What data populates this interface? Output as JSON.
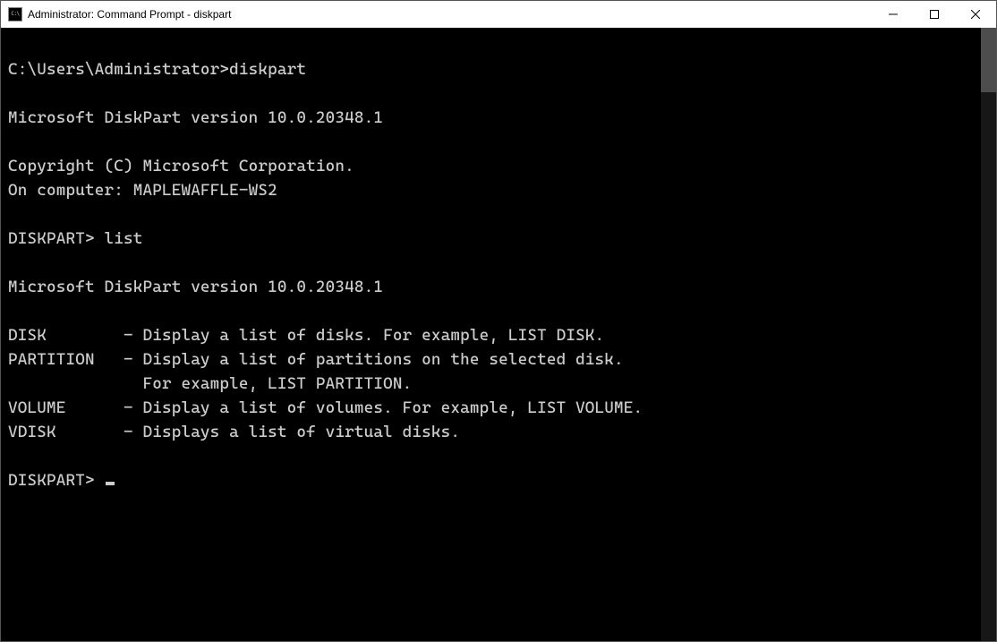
{
  "window": {
    "title": "Administrator: Command Prompt - diskpart"
  },
  "terminal": {
    "lines": [
      "",
      "C:\\Users\\Administrator>diskpart",
      "",
      "Microsoft DiskPart version 10.0.20348.1",
      "",
      "Copyright (C) Microsoft Corporation.",
      "On computer: MAPLEWAFFLE-WS2",
      "",
      "DISKPART> list",
      "",
      "Microsoft DiskPart version 10.0.20348.1",
      "",
      "DISK        - Display a list of disks. For example, LIST DISK.",
      "PARTITION   - Display a list of partitions on the selected disk.",
      "              For example, LIST PARTITION.",
      "VOLUME      - Display a list of volumes. For example, LIST VOLUME.",
      "VDISK       - Displays a list of virtual disks.",
      "",
      "DISKPART> "
    ]
  }
}
